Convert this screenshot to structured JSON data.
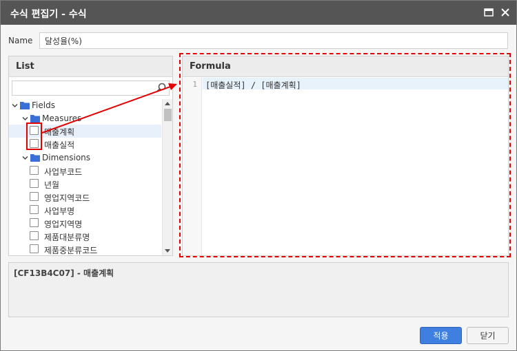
{
  "window": {
    "title": "수식 편집기 - 수식",
    "maximize_icon": "maximize-icon",
    "close_icon": "close-icon"
  },
  "name_field": {
    "label": "Name",
    "value": "달성율(%)"
  },
  "list_panel": {
    "header": "List",
    "search_value": "",
    "tree": {
      "root": "Fields",
      "groups": [
        {
          "label": "Measures",
          "items": [
            "매출계획",
            "매출실적"
          ],
          "selected_index": 0
        },
        {
          "label": "Dimensions",
          "items": [
            "사업부코드",
            "년월",
            "영업지역코드",
            "사업부명",
            "영업지역명",
            "제품대분류명",
            "제품중분류코드"
          ]
        }
      ]
    }
  },
  "formula_panel": {
    "header": "Formula",
    "lines": [
      {
        "number": "1",
        "text": "[매출실적] / [매출계획]"
      }
    ]
  },
  "description": {
    "code": "[CF13B4C07]",
    "text": " - 매출계획"
  },
  "buttons": {
    "apply": "적용",
    "close": "닫기"
  },
  "colors": {
    "titlebar": "#555555",
    "accent_blue": "#3f7fe0",
    "annotation_red": "#e30000",
    "folder_blue": "#3b6fd8"
  }
}
